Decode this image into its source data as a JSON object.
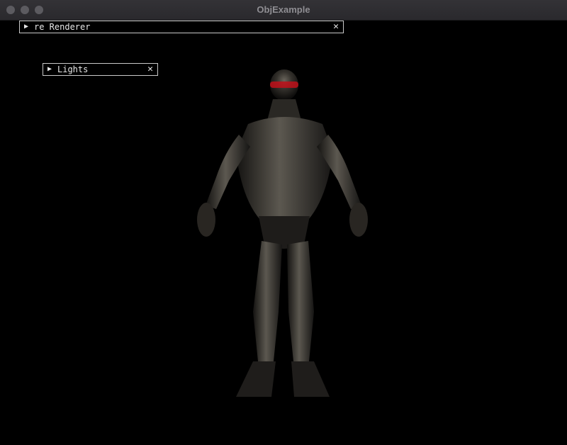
{
  "window": {
    "title": "ObjExample"
  },
  "panels": [
    {
      "label": "re Renderer",
      "arrow": "▶",
      "close": "✕"
    },
    {
      "label": "Lights",
      "arrow": "▶",
      "close": "✕"
    }
  ],
  "icons": {
    "expand": "triangle-right-icon",
    "close": "close-icon"
  },
  "colors": {
    "titlebar": "#2e2d31",
    "title_text": "#8f8e93",
    "viewport": "#000000",
    "panel_border": "#c9c9c9",
    "visor": "#c0101a"
  }
}
